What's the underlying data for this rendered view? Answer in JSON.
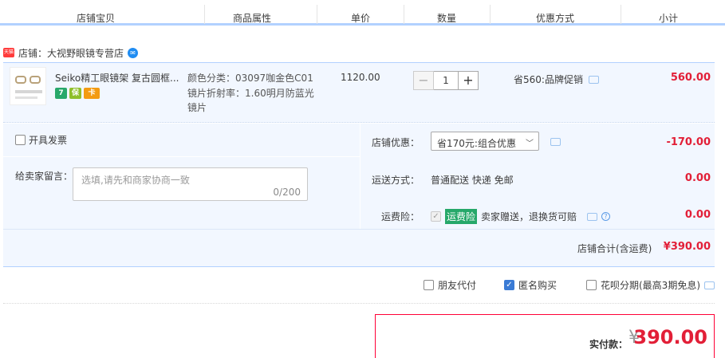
{
  "header": {
    "col_item": "店铺宝贝",
    "col_attr": "商品属性",
    "col_price": "单价",
    "col_qty": "数量",
    "col_promo": "优惠方式",
    "col_subtotal": "小计"
  },
  "shop": {
    "badge": "天猫",
    "name": "店铺：大视野眼镜专营店",
    "chat_icon": "wangwang-icon"
  },
  "item": {
    "title": "Seiko精工眼镜架 复古圆框...",
    "tags": [
      "7",
      "保",
      "卡"
    ],
    "attr_color": "颜色分类：03097咖金色C01",
    "attr_lens": "镜片折射率：1.60明月防蓝光",
    "attr_lens_2": "镜片",
    "price": "1120.00",
    "qty": "1",
    "qty_minus": "−",
    "qty_plus": "+",
    "promo": "省560:品牌促销",
    "subtotal": "560.00"
  },
  "invoice": {
    "label": "开具发票",
    "checked": false
  },
  "memo": {
    "label": "给卖家留言：",
    "placeholder": "选填,请先和商家协商一致",
    "count": "0/200"
  },
  "shop_discount": {
    "label": "店铺优惠：",
    "selected": "省170元:组合优惠",
    "amount": "-170.00"
  },
  "shipping": {
    "label": "运送方式：",
    "method": "普通配送 快递 免邮",
    "amount": "0.00"
  },
  "freight_insurance": {
    "label": "运费险：",
    "badge": "运费险",
    "desc": "卖家赠送，退换货可赔",
    "amount": "0.00"
  },
  "shop_total": {
    "label": "店铺合计(含运费)",
    "amount": "¥390.00"
  },
  "options": [
    {
      "label": "朋友代付",
      "checked": false
    },
    {
      "label": "匿名购买",
      "checked": true
    },
    {
      "label": "花呗分期(最高3期免息)",
      "checked": false
    }
  ],
  "payment": {
    "label": "实付款：",
    "currency": "¥",
    "amount": "390.00"
  },
  "colors": {
    "accent": "#e21f37",
    "row_bg": "#f2f7ff",
    "border_blue": "#b2d1ff"
  }
}
